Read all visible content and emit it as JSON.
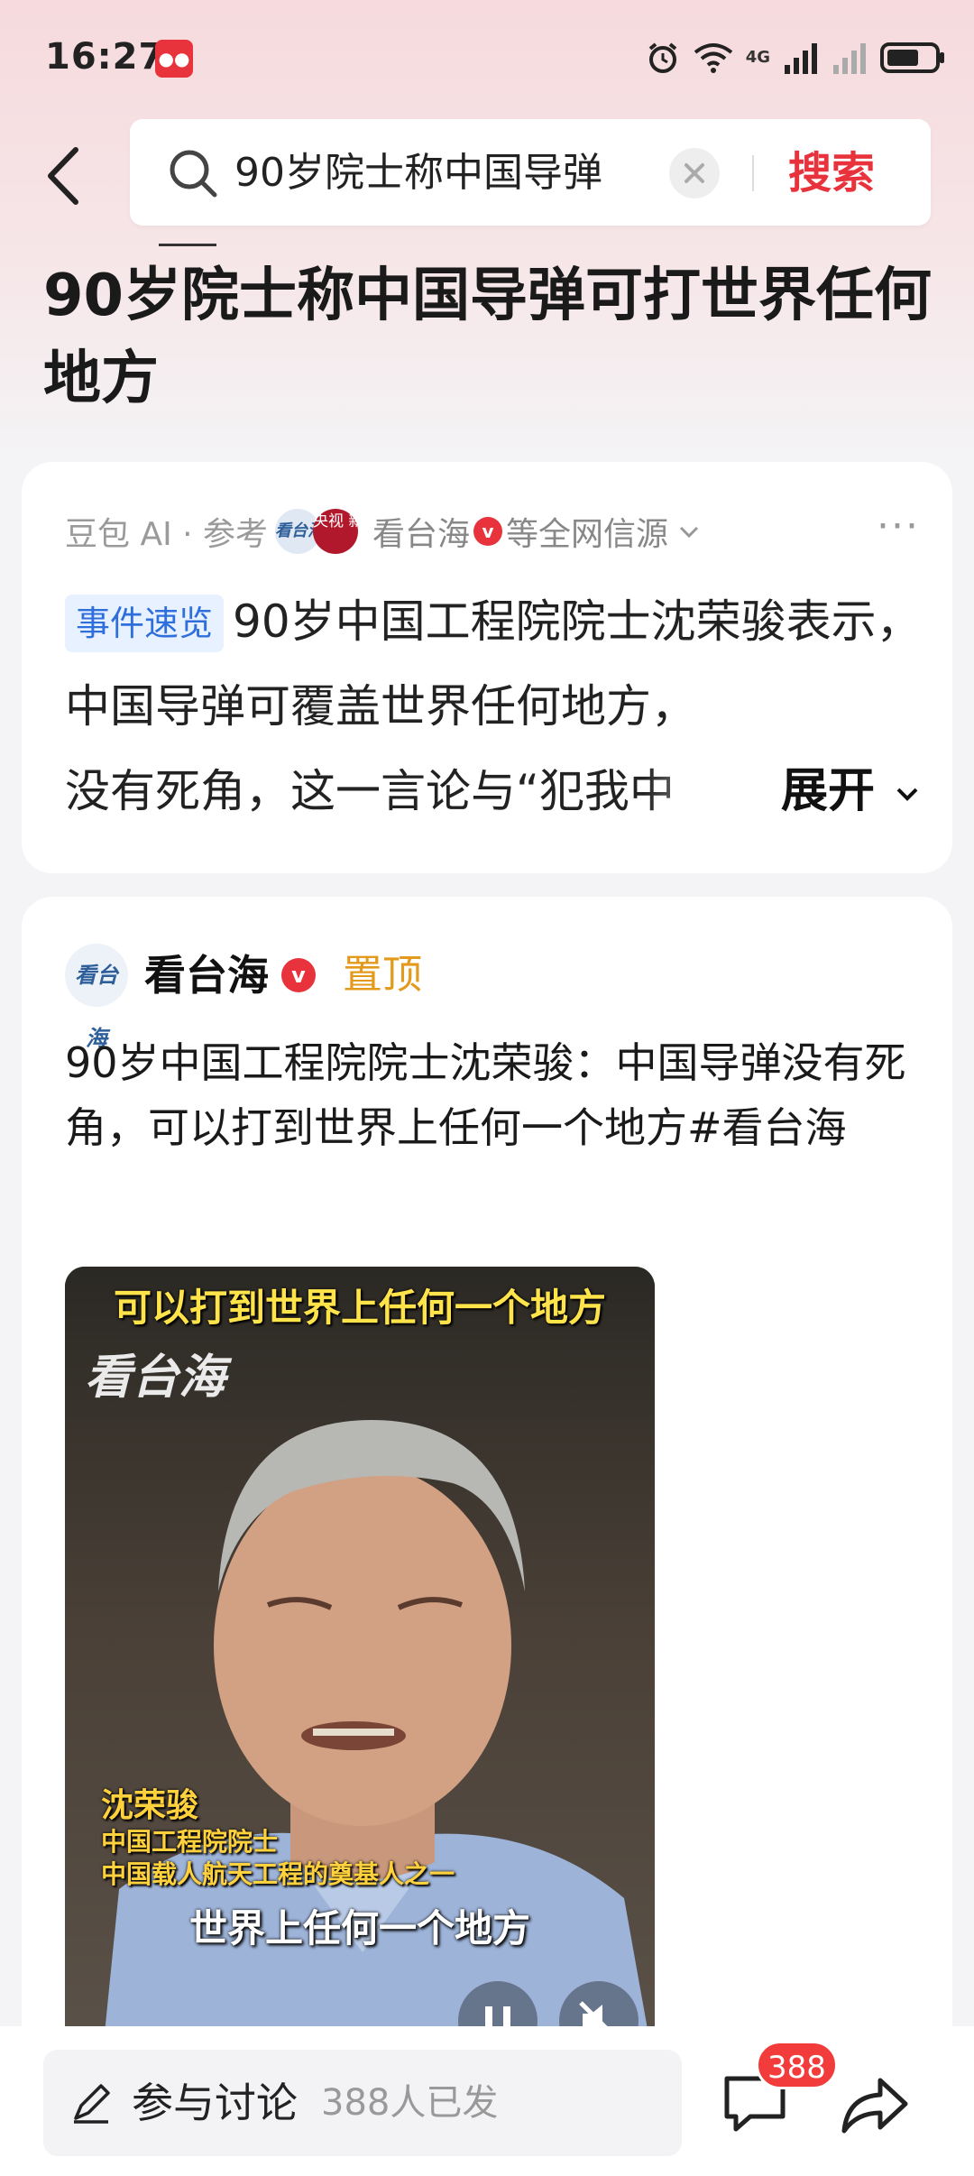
{
  "status_bar": {
    "time": "16:27",
    "app_badge": "●●",
    "network": "4G"
  },
  "search": {
    "query": "90岁院士称中国导弹",
    "button_label": "搜索"
  },
  "headline": "90岁院士称中国导弹可打世界任何地方",
  "ai_summary": {
    "source_prefix": "豆包 AI · 参考",
    "source_logo_1": "看台海",
    "source_logo_2": "央视\n新闻",
    "source_name": "看台海",
    "verified": "v",
    "source_suffix": "等全网信源",
    "tag": "事件速览",
    "text_1": "90岁中国工程院院士沈荣骏表示，中国导弹可覆盖世界任何地方，",
    "text_2": "没有死角，这一言论与“犯我中",
    "expand_label": "展开"
  },
  "post": {
    "avatar": "看台海",
    "author": "看台海",
    "verified": "v",
    "pinned": "置顶",
    "text": "90岁中国工程院院士沈荣骏：中国导弹没有死角，可以打到世界上任何一个地方#看台海",
    "video": {
      "caption_top": "可以打到世界上任何一个地方",
      "watermark": "看台海",
      "person_name": "沈荣骏",
      "person_title_1": "中国工程院院士",
      "person_title_2": "中国载人航天工程的奠基人之一",
      "caption_bottom": "世界上任何一个地方"
    }
  },
  "bottom_bar": {
    "discuss_label": "参与讨论",
    "discuss_count": "388人已发",
    "comment_badge": "388"
  },
  "colors": {
    "accent_red": "#e8323c",
    "pinned_orange": "#e39a1c",
    "tag_blue": "#2f6fdc"
  },
  "icons": [
    "back-arrow-icon",
    "search-icon",
    "clear-icon",
    "verified-icon",
    "chevron-down-icon",
    "more-icon",
    "pause-icon",
    "mute-icon",
    "pen-icon",
    "comment-icon",
    "share-icon",
    "wifi-icon",
    "signal-icon",
    "battery-icon",
    "alarm-icon"
  ]
}
